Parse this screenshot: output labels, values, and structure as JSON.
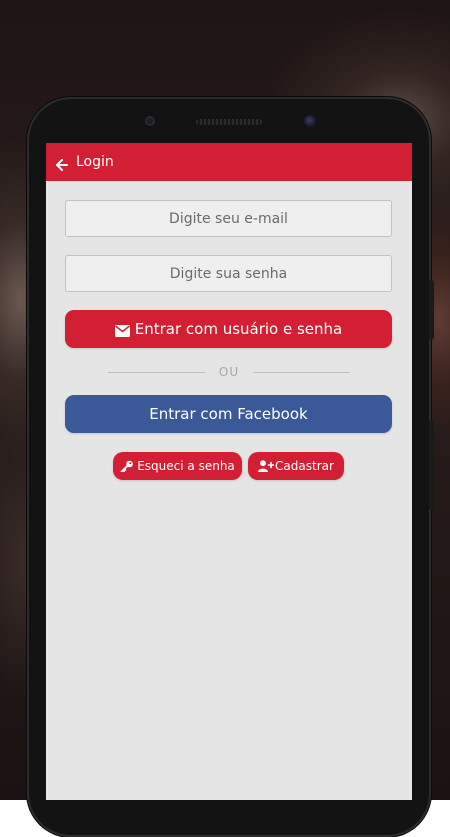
{
  "colors": {
    "brand_red": "#d21f33",
    "facebook_blue": "#3b5898",
    "screen_background": "#e5e5e5"
  },
  "header": {
    "back_icon": "arrow-left-icon",
    "title": "Login"
  },
  "form": {
    "email_placeholder": "Digite seu e-mail",
    "email_value": "",
    "password_placeholder": "Digite sua senha",
    "password_value": "",
    "login_button_icon": "envelope-icon",
    "login_button_label": "Entrar com usuário e senha",
    "divider_text": "OU",
    "facebook_button_label": "Entrar com Facebook",
    "forgot_icon": "key-icon",
    "forgot_label": "Esqueci a senha",
    "register_icon": "user-plus-icon",
    "register_label": "Cadastrar"
  }
}
